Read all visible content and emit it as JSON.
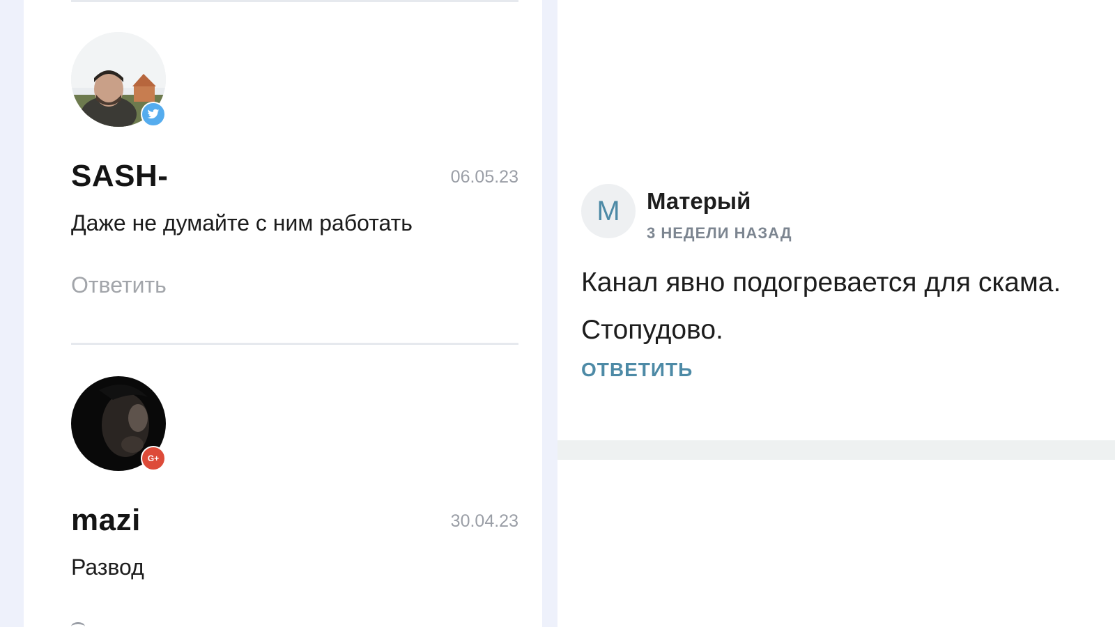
{
  "left_comments": [
    {
      "name": "SASH-",
      "date": "06.05.23",
      "text": "Даже не думайте с ним работать",
      "reply_label": "Ответить",
      "social_icon": "twitter-icon",
      "social_color": "#55acee"
    },
    {
      "name": "mazi",
      "date": "30.04.23",
      "text": "Развод",
      "reply_label": "",
      "social_icon": "google-plus-icon",
      "social_color": "#dd4b39",
      "social_glyph": "G+"
    }
  ],
  "right_comment": {
    "avatar_letter": "М",
    "author": "Матерый",
    "time": "3 НЕДЕЛИ НАЗАД",
    "text_line1": "Канал явно подогревается для скама.",
    "text_line2": "Стопудово.",
    "reply_label": "ОТВЕТИТЬ",
    "accent_color": "#4d8aa6"
  }
}
